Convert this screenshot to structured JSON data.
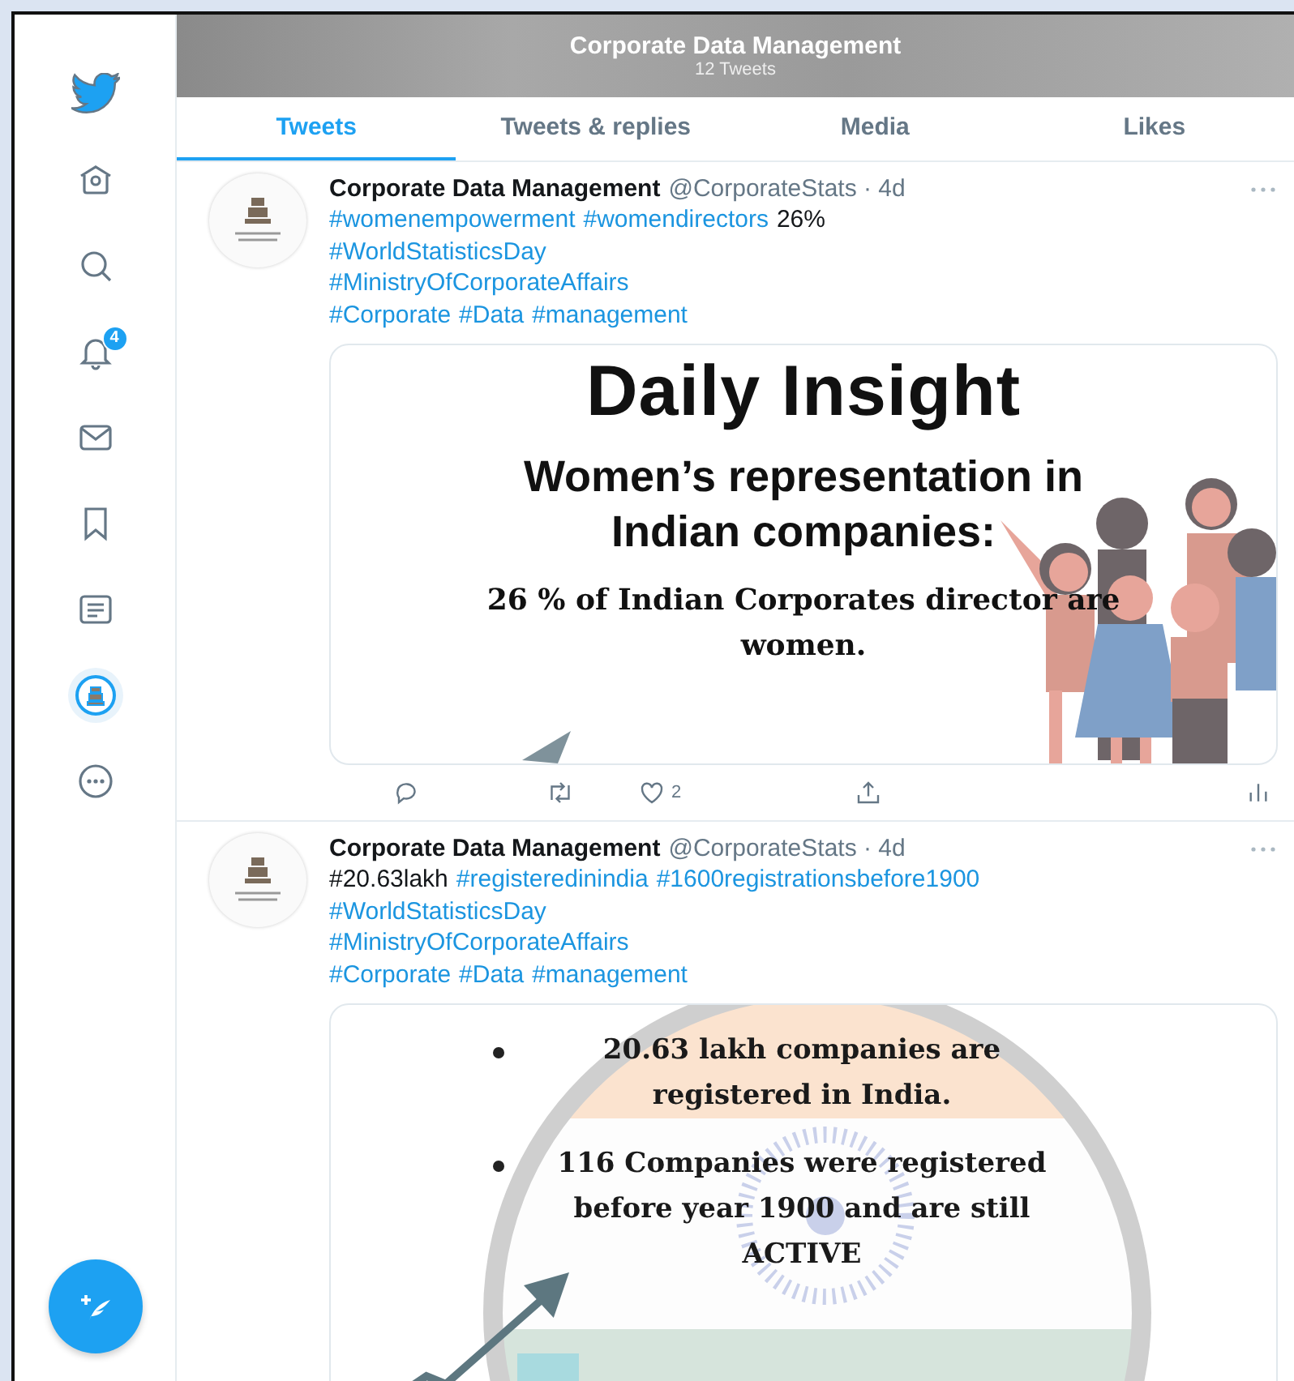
{
  "sidebar": {
    "items": [
      {
        "kind": "logo",
        "selected": false
      },
      {
        "kind": "home",
        "selected": false
      },
      {
        "kind": "search",
        "selected": false
      },
      {
        "kind": "notifications",
        "selected": false,
        "badge": "4"
      },
      {
        "kind": "messages",
        "selected": false
      },
      {
        "kind": "bookmarks",
        "selected": false
      },
      {
        "kind": "lists",
        "selected": false
      },
      {
        "kind": "profile",
        "selected": true
      },
      {
        "kind": "more",
        "selected": false
      }
    ]
  },
  "header": {
    "title": "Corporate Data Management",
    "subtitle": "12 Tweets"
  },
  "tabs": [
    {
      "label": "Tweets",
      "selected": true
    },
    {
      "label": "Tweets & replies",
      "selected": false
    },
    {
      "label": "Media",
      "selected": false
    },
    {
      "label": "Likes",
      "selected": false
    }
  ],
  "tweets": [
    {
      "author": "Corporate Data Management",
      "meta": "@CorporateStats · 4d",
      "lines": [
        [
          {
            "kind": "hashtag",
            "text": "#womenempowerment"
          },
          {
            "kind": "hashtag",
            "text": "#womendirectors"
          },
          {
            "kind": "plain",
            "text": "26%"
          }
        ],
        [
          {
            "kind": "hashtag",
            "text": "#WorldStatisticsDay"
          }
        ],
        [
          {
            "kind": "hashtag",
            "text": "#MinistryOfCorporateAffairs"
          }
        ],
        [
          {
            "kind": "hashtag",
            "text": "#Corporate"
          },
          {
            "kind": "hashtag",
            "text": "#Data"
          },
          {
            "kind": "hashtag",
            "text": "#management"
          }
        ]
      ],
      "card": {
        "kind": "insight",
        "title": "Daily Insight",
        "subtitle": "Women’s representation in Indian companies:",
        "body": "26 % of Indian Corporates director are women."
      },
      "likes": "2"
    },
    {
      "author": "Corporate Data Management",
      "meta": "@CorporateStats · 4d",
      "lines": [
        [
          {
            "kind": "plain",
            "text": "#20.63lakh"
          },
          {
            "kind": "hashtag",
            "text": "#registeredinindia"
          },
          {
            "kind": "hashtag",
            "text": "#1600registrationsbefore1900"
          }
        ],
        [
          {
            "kind": "hashtag",
            "text": "#WorldStatisticsDay"
          }
        ],
        [
          {
            "kind": "hashtag",
            "text": "#MinistryOfCorporateAffairs"
          }
        ],
        [
          {
            "kind": "hashtag",
            "text": "#Corporate"
          },
          {
            "kind": "hashtag",
            "text": "#Data"
          },
          {
            "kind": "hashtag",
            "text": "#management"
          }
        ]
      ],
      "card": {
        "kind": "bullets",
        "bullets": [
          "20.63 lakh companies are registered in India.",
          "116 Companies were registered before year 1900 and are still ACTIVE"
        ]
      }
    }
  ]
}
